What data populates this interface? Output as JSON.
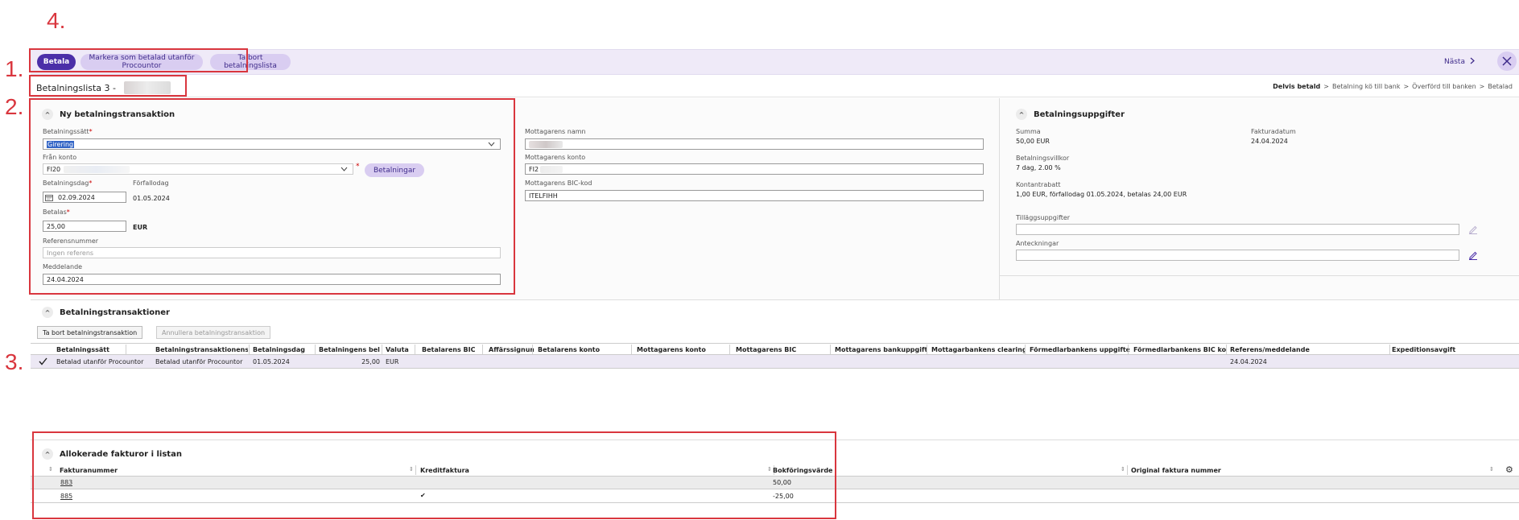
{
  "annotations": [
    "1.",
    "2.",
    "3.",
    "4."
  ],
  "toolbar": {
    "pay_label": "Betala",
    "mark_paid_label": "Markera som betalad utanför Procountor",
    "remove_list_label": "Ta bort betalningslista",
    "next_label": "Nästa",
    "next_icon": "chevron-right-icon",
    "close_icon": "close-icon"
  },
  "title": {
    "list_title": "Betalningslista 3 -",
    "breadcrumb": {
      "step1": "Delvis betald",
      "step2": "Betalning kö till bank",
      "step3": "Överförd till banken",
      "step4": "Betalad"
    }
  },
  "new_transaction": {
    "heading": "Ny betalningstransaktion",
    "payment_method_label": "Betalningssätt",
    "payment_method_value": "Girering",
    "from_account_label": "Från konto",
    "from_account_value": "FI20",
    "payments_button": "Betalningar",
    "payment_date_label": "Betalningsdag",
    "payment_date_value": "02.09.2024",
    "due_date_label": "Förfallodag",
    "due_date_value": "01.05.2024",
    "amount_label": "Betalas",
    "amount_value": "25,00",
    "currency": "EUR",
    "reference_label": "Referensnummer",
    "reference_placeholder": "Ingen referens",
    "message_label": "Meddelande",
    "message_value": "24.04.2024",
    "required_mark": "*"
  },
  "recipient": {
    "name_label": "Mottagarens namn",
    "account_label": "Mottagarens konto",
    "account_value": "FI2",
    "bic_label": "Mottagarens BIC-kod",
    "bic_value": "ITELFIHH"
  },
  "payment_info": {
    "heading": "Betalningsuppgifter",
    "sum_label": "Summa",
    "sum_value": "50,00 EUR",
    "invoice_date_label": "Fakturadatum",
    "invoice_date_value": "24.04.2024",
    "terms_label": "Betalningsvillkor",
    "terms_value": "7 dag, 2.00 %",
    "discount_label": "Kontantrabatt",
    "discount_value": "1,00 EUR, förfallodag 01.05.2024, betalas 24,00 EUR",
    "extra_label": "Tilläggsuppgifter",
    "notes_label": "Anteckningar"
  },
  "transactions": {
    "heading": "Betalningstransaktioner",
    "remove_button": "Ta bort betalningstransaktion",
    "cancel_button": "Annullera betalningstransaktion",
    "columns": [
      "Betalningssätt",
      "Betalningstransaktionens st",
      "Betalningsdag",
      "Betalningens belo",
      "Valuta",
      "Betalarens BIC",
      "Affärssignum",
      "Betalarens konto",
      "Mottagarens konto",
      "Mottagarens BIC",
      "Mottagarens bankuppgifter",
      "Mottagarbankens clearingk",
      "Förmedlarbankens uppgifter",
      "Förmedlarbankens BIC kod",
      "Referens/meddelande",
      "Expeditionsavgift"
    ],
    "rows": [
      [
        "Betalad utanför Procountor",
        "Betalad utanför Procountor",
        "01.05.2024",
        "25,00",
        "EUR",
        "",
        "",
        "",
        "",
        "",
        "",
        "",
        "",
        "",
        "24.04.2024",
        ""
      ]
    ]
  },
  "invoices": {
    "heading": "Allokerade fakturor i listan",
    "columns": [
      "Fakturanummer",
      "Kreditfaktura",
      "Bokföringsvärde",
      "Original faktura nummer"
    ],
    "rows": [
      {
        "number": "883",
        "credit": "",
        "value": "50,00",
        "original": ""
      },
      {
        "number": "885",
        "credit": "✔",
        "value": "-25,00",
        "original": ""
      }
    ]
  }
}
